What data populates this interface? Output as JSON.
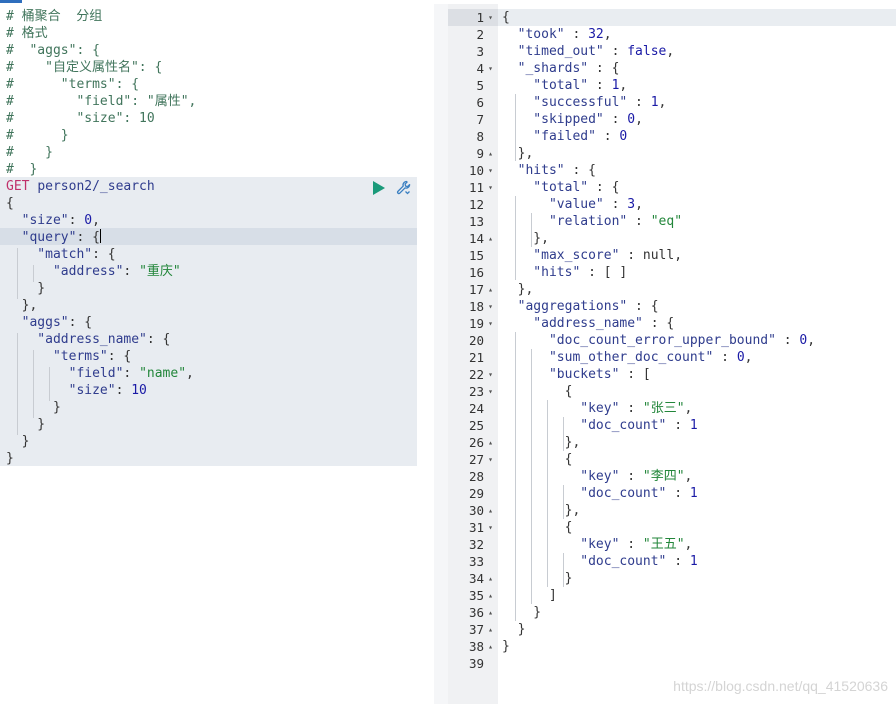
{
  "left_lines": [
    {
      "text": "# 桶聚合  分组",
      "cls": "c"
    },
    {
      "text": "# 格式",
      "cls": "c"
    },
    {
      "text": "#  \"aggs\": {",
      "cls": "c"
    },
    {
      "text": "#    \"自定义属性名\": {",
      "cls": "c"
    },
    {
      "text": "#      \"terms\": {",
      "cls": "c"
    },
    {
      "text": "#        \"field\": \"属性\",",
      "cls": "c"
    },
    {
      "text": "#        \"size\": 10",
      "cls": "c"
    },
    {
      "text": "#      }",
      "cls": "c"
    },
    {
      "text": "#    }",
      "cls": "c"
    },
    {
      "text": "#  }",
      "cls": "c"
    },
    {
      "parts": [
        {
          "t": "GET ",
          "c": "m"
        },
        {
          "t": "person2/_search",
          "c": "u"
        }
      ]
    },
    {
      "parts": [
        {
          "t": "{",
          "c": "p"
        }
      ]
    },
    {
      "parts": [
        {
          "t": "  \"size\"",
          "c": "k"
        },
        {
          "t": ": ",
          "c": "p"
        },
        {
          "t": "0",
          "c": "n"
        },
        {
          "t": ",",
          "c": "p"
        }
      ]
    },
    {
      "parts": [
        {
          "t": "  \"query\"",
          "c": "k"
        },
        {
          "t": ": {",
          "c": "p"
        }
      ],
      "caret": true
    },
    {
      "parts": [
        {
          "t": "    \"match\"",
          "c": "k"
        },
        {
          "t": ": {",
          "c": "p"
        }
      ]
    },
    {
      "parts": [
        {
          "t": "      \"address\"",
          "c": "k"
        },
        {
          "t": ": ",
          "c": "p"
        },
        {
          "t": "\"重庆\"",
          "c": "s"
        }
      ]
    },
    {
      "parts": [
        {
          "t": "    }",
          "c": "p"
        }
      ]
    },
    {
      "parts": [
        {
          "t": "  },",
          "c": "p"
        }
      ]
    },
    {
      "parts": [
        {
          "t": "  \"aggs\"",
          "c": "k"
        },
        {
          "t": ": {",
          "c": "p"
        }
      ]
    },
    {
      "parts": [
        {
          "t": "    \"address_name\"",
          "c": "k"
        },
        {
          "t": ": {",
          "c": "p"
        }
      ]
    },
    {
      "parts": [
        {
          "t": "      \"terms\"",
          "c": "k"
        },
        {
          "t": ": {",
          "c": "p"
        }
      ]
    },
    {
      "parts": [
        {
          "t": "        \"field\"",
          "c": "k"
        },
        {
          "t": ": ",
          "c": "p"
        },
        {
          "t": "\"name\"",
          "c": "s"
        },
        {
          "t": ",",
          "c": "p"
        }
      ]
    },
    {
      "parts": [
        {
          "t": "        \"size\"",
          "c": "k"
        },
        {
          "t": ": ",
          "c": "p"
        },
        {
          "t": "10",
          "c": "n"
        }
      ]
    },
    {
      "parts": [
        {
          "t": "      }",
          "c": "p"
        }
      ]
    },
    {
      "parts": [
        {
          "t": "    }",
          "c": "p"
        }
      ]
    },
    {
      "parts": [
        {
          "t": "  }",
          "c": "p"
        }
      ]
    },
    {
      "parts": [
        {
          "t": "}",
          "c": "p"
        }
      ]
    }
  ],
  "right_lines": [
    {
      "n": "1",
      "f": "▾",
      "parts": [
        {
          "t": "{",
          "c": "p"
        }
      ]
    },
    {
      "n": "2",
      "parts": [
        {
          "t": "  \"took\"",
          "c": "k"
        },
        {
          "t": " : ",
          "c": "p"
        },
        {
          "t": "32",
          "c": "n"
        },
        {
          "t": ",",
          "c": "p"
        }
      ]
    },
    {
      "n": "3",
      "parts": [
        {
          "t": "  \"timed_out\"",
          "c": "k"
        },
        {
          "t": " : ",
          "c": "p"
        },
        {
          "t": "false",
          "c": "n"
        },
        {
          "t": ",",
          "c": "p"
        }
      ]
    },
    {
      "n": "4",
      "f": "▾",
      "parts": [
        {
          "t": "  \"_shards\"",
          "c": "k"
        },
        {
          "t": " : {",
          "c": "p"
        }
      ]
    },
    {
      "n": "5",
      "parts": [
        {
          "t": "    \"total\"",
          "c": "k"
        },
        {
          "t": " : ",
          "c": "p"
        },
        {
          "t": "1",
          "c": "n"
        },
        {
          "t": ",",
          "c": "p"
        }
      ]
    },
    {
      "n": "6",
      "parts": [
        {
          "t": "    \"successful\"",
          "c": "k"
        },
        {
          "t": " : ",
          "c": "p"
        },
        {
          "t": "1",
          "c": "n"
        },
        {
          "t": ",",
          "c": "p"
        }
      ]
    },
    {
      "n": "7",
      "parts": [
        {
          "t": "    \"skipped\"",
          "c": "k"
        },
        {
          "t": " : ",
          "c": "p"
        },
        {
          "t": "0",
          "c": "n"
        },
        {
          "t": ",",
          "c": "p"
        }
      ]
    },
    {
      "n": "8",
      "parts": [
        {
          "t": "    \"failed\"",
          "c": "k"
        },
        {
          "t": " : ",
          "c": "p"
        },
        {
          "t": "0",
          "c": "n"
        }
      ]
    },
    {
      "n": "9",
      "f": "▴",
      "parts": [
        {
          "t": "  },",
          "c": "p"
        }
      ]
    },
    {
      "n": "10",
      "f": "▾",
      "parts": [
        {
          "t": "  \"hits\"",
          "c": "k"
        },
        {
          "t": " : {",
          "c": "p"
        }
      ]
    },
    {
      "n": "11",
      "f": "▾",
      "parts": [
        {
          "t": "    \"total\"",
          "c": "k"
        },
        {
          "t": " : {",
          "c": "p"
        }
      ]
    },
    {
      "n": "12",
      "parts": [
        {
          "t": "      \"value\"",
          "c": "k"
        },
        {
          "t": " : ",
          "c": "p"
        },
        {
          "t": "3",
          "c": "n"
        },
        {
          "t": ",",
          "c": "p"
        }
      ]
    },
    {
      "n": "13",
      "parts": [
        {
          "t": "      \"relation\"",
          "c": "k"
        },
        {
          "t": " : ",
          "c": "p"
        },
        {
          "t": "\"eq\"",
          "c": "s"
        }
      ]
    },
    {
      "n": "14",
      "f": "▴",
      "parts": [
        {
          "t": "    },",
          "c": "p"
        }
      ]
    },
    {
      "n": "15",
      "parts": [
        {
          "t": "    \"max_score\"",
          "c": "k"
        },
        {
          "t": " : ",
          "c": "p"
        },
        {
          "t": "null",
          "c": "p"
        },
        {
          "t": ",",
          "c": "p"
        }
      ]
    },
    {
      "n": "16",
      "parts": [
        {
          "t": "    \"hits\"",
          "c": "k"
        },
        {
          "t": " : [ ]",
          "c": "p"
        }
      ]
    },
    {
      "n": "17",
      "f": "▴",
      "parts": [
        {
          "t": "  },",
          "c": "p"
        }
      ]
    },
    {
      "n": "18",
      "f": "▾",
      "parts": [
        {
          "t": "  \"aggregations\"",
          "c": "k"
        },
        {
          "t": " : {",
          "c": "p"
        }
      ]
    },
    {
      "n": "19",
      "f": "▾",
      "parts": [
        {
          "t": "    \"address_name\"",
          "c": "k"
        },
        {
          "t": " : {",
          "c": "p"
        }
      ]
    },
    {
      "n": "20",
      "parts": [
        {
          "t": "      \"doc_count_error_upper_bound\"",
          "c": "k"
        },
        {
          "t": " : ",
          "c": "p"
        },
        {
          "t": "0",
          "c": "n"
        },
        {
          "t": ",",
          "c": "p"
        }
      ]
    },
    {
      "n": "21",
      "parts": [
        {
          "t": "      \"sum_other_doc_count\"",
          "c": "k"
        },
        {
          "t": " : ",
          "c": "p"
        },
        {
          "t": "0",
          "c": "n"
        },
        {
          "t": ",",
          "c": "p"
        }
      ]
    },
    {
      "n": "22",
      "f": "▾",
      "parts": [
        {
          "t": "      \"buckets\"",
          "c": "k"
        },
        {
          "t": " : [",
          "c": "p"
        }
      ]
    },
    {
      "n": "23",
      "f": "▾",
      "parts": [
        {
          "t": "        {",
          "c": "p"
        }
      ]
    },
    {
      "n": "24",
      "parts": [
        {
          "t": "          \"key\"",
          "c": "k"
        },
        {
          "t": " : ",
          "c": "p"
        },
        {
          "t": "\"张三\"",
          "c": "s"
        },
        {
          "t": ",",
          "c": "p"
        }
      ]
    },
    {
      "n": "25",
      "parts": [
        {
          "t": "          \"doc_count\"",
          "c": "k"
        },
        {
          "t": " : ",
          "c": "p"
        },
        {
          "t": "1",
          "c": "n"
        }
      ]
    },
    {
      "n": "26",
      "f": "▴",
      "parts": [
        {
          "t": "        },",
          "c": "p"
        }
      ]
    },
    {
      "n": "27",
      "f": "▾",
      "parts": [
        {
          "t": "        {",
          "c": "p"
        }
      ]
    },
    {
      "n": "28",
      "parts": [
        {
          "t": "          \"key\"",
          "c": "k"
        },
        {
          "t": " : ",
          "c": "p"
        },
        {
          "t": "\"李四\"",
          "c": "s"
        },
        {
          "t": ",",
          "c": "p"
        }
      ]
    },
    {
      "n": "29",
      "parts": [
        {
          "t": "          \"doc_count\"",
          "c": "k"
        },
        {
          "t": " : ",
          "c": "p"
        },
        {
          "t": "1",
          "c": "n"
        }
      ]
    },
    {
      "n": "30",
      "f": "▴",
      "parts": [
        {
          "t": "        },",
          "c": "p"
        }
      ]
    },
    {
      "n": "31",
      "f": "▾",
      "parts": [
        {
          "t": "        {",
          "c": "p"
        }
      ]
    },
    {
      "n": "32",
      "parts": [
        {
          "t": "          \"key\"",
          "c": "k"
        },
        {
          "t": " : ",
          "c": "p"
        },
        {
          "t": "\"王五\"",
          "c": "s"
        },
        {
          "t": ",",
          "c": "p"
        }
      ]
    },
    {
      "n": "33",
      "parts": [
        {
          "t": "          \"doc_count\"",
          "c": "k"
        },
        {
          "t": " : ",
          "c": "p"
        },
        {
          "t": "1",
          "c": "n"
        }
      ]
    },
    {
      "n": "34",
      "f": "▴",
      "parts": [
        {
          "t": "        }",
          "c": "p"
        }
      ]
    },
    {
      "n": "35",
      "f": "▴",
      "parts": [
        {
          "t": "      ]",
          "c": "p"
        }
      ]
    },
    {
      "n": "36",
      "f": "▴",
      "parts": [
        {
          "t": "    }",
          "c": "p"
        }
      ]
    },
    {
      "n": "37",
      "f": "▴",
      "parts": [
        {
          "t": "  }",
          "c": "p"
        }
      ]
    },
    {
      "n": "38",
      "f": "▴",
      "parts": [
        {
          "t": "}",
          "c": "p"
        }
      ]
    },
    {
      "n": "39",
      "parts": []
    }
  ],
  "icons": {
    "run": "play-icon",
    "settings": "wrench-icon"
  },
  "colors": {
    "run_button": "#1a9a7a",
    "wrench": "#3a7fc1",
    "method": "#c0306a"
  },
  "watermark": "https://blog.csdn.net/qq_41520636"
}
